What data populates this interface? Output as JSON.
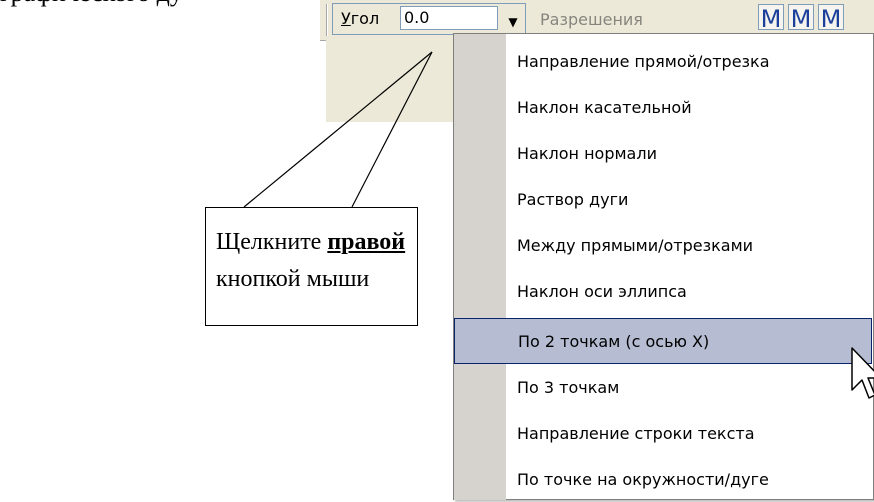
{
  "document": {
    "top_text": "графического ду"
  },
  "toolbar": {
    "angle_label_accel": "У",
    "angle_label_rest": "гол",
    "angle_value": "0.0",
    "dropdown_arrow": "▼",
    "resolution_label": "Разрешения",
    "m_buttons": [
      "M",
      "M",
      "M"
    ]
  },
  "callout": {
    "line1_prefix": "Щелкните ",
    "line1_emph": "правой",
    "line2": "кнопкой мыши"
  },
  "context_menu": {
    "items": [
      "Направление прямой/отрезка",
      "Наклон касательной",
      "Наклон нормали",
      "Раствор дуги",
      "Между прямыми/отрезками",
      "Наклон оси эллипса",
      "По 2 точкам (с осью X)",
      "По 3 точкам",
      "Направление строки текста",
      "По точке на окружности/дуге"
    ],
    "highlighted_index": 6
  },
  "colors": {
    "toolbar_bg": "#ece9d8",
    "menu_gutter": "#d6d3ce",
    "menu_highlight": "#b6bdd2",
    "menu_highlight_border": "#0a246a",
    "m_button_text": "#1b3f9a"
  }
}
